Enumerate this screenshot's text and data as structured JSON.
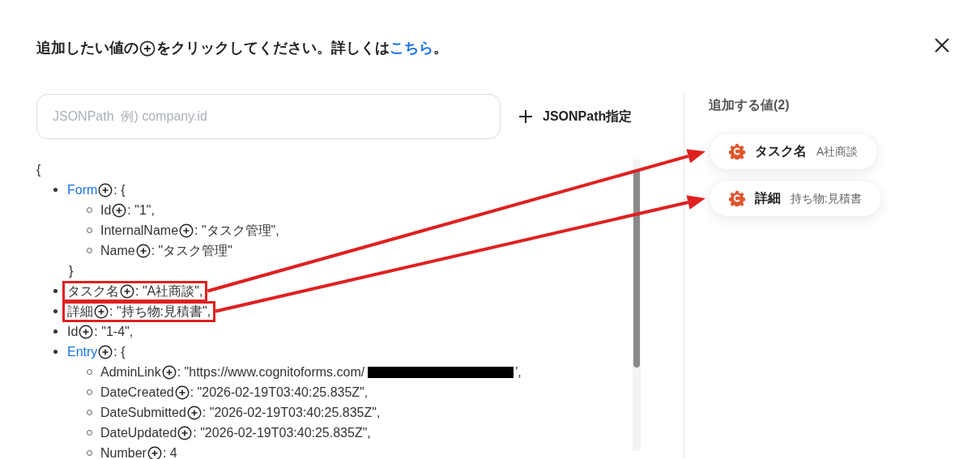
{
  "heading": [
    {
      "kind": "text",
      "text": "追加したい値の"
    },
    {
      "kind": "plus"
    },
    {
      "kind": "text",
      "text": "をクリックしてください。詳しくは"
    },
    {
      "kind": "link",
      "text": "こちら"
    },
    {
      "kind": "text",
      "text": "。"
    }
  ],
  "search": {
    "placeholder": "JSONPath  例) company.id"
  },
  "add_path_button": {
    "label": "JSONPath指定"
  },
  "tree": {
    "open": "{",
    "items": [
      {
        "key": "Form",
        "kind": "object",
        "rest": ": {",
        "closing": "}",
        "annotated": false,
        "children": [
          {
            "key": "Id",
            "kind": "value",
            "rest": ": \"1\","
          },
          {
            "key": "InternalName",
            "kind": "value",
            "rest": ": \"タスク管理\","
          },
          {
            "key": "Name",
            "kind": "value",
            "rest": ": \"タスク管理\""
          }
        ]
      },
      {
        "key": "タスク名",
        "kind": "value",
        "rest": ": \"A社商談\",",
        "annotated": true
      },
      {
        "key": "詳細",
        "kind": "value",
        "rest": ": \"持ち物:見積書\",",
        "annotated": true
      },
      {
        "key": "Id",
        "kind": "value",
        "rest": ": \"1-4\",",
        "annotated": false
      },
      {
        "key": "Entry",
        "kind": "object",
        "rest": ": {",
        "annotated": false,
        "children": [
          {
            "key": "AdminLink",
            "kind": "value",
            "rest": ": \"https://www.cognitoforms.com/",
            "redacted": true,
            "rest_end": "',"
          },
          {
            "key": "DateCreated",
            "kind": "value",
            "rest": ": \"2026-02-19T03:40:25.835Z\","
          },
          {
            "key": "DateSubmitted",
            "kind": "value",
            "rest": ": \"2026-02-19T03:40:25.835Z\","
          },
          {
            "key": "DateUpdated",
            "kind": "value",
            "rest": ": \"2026-02-19T03:40:25.835Z\","
          },
          {
            "key": "Number",
            "kind": "value",
            "rest": ": 4"
          }
        ]
      }
    ]
  },
  "selected_panel": {
    "title": "追加する値(2)",
    "chips": [
      {
        "label": "タスク名",
        "value": "A社商談"
      },
      {
        "label": "詳細",
        "value": "持ち物:見積書"
      }
    ]
  }
}
